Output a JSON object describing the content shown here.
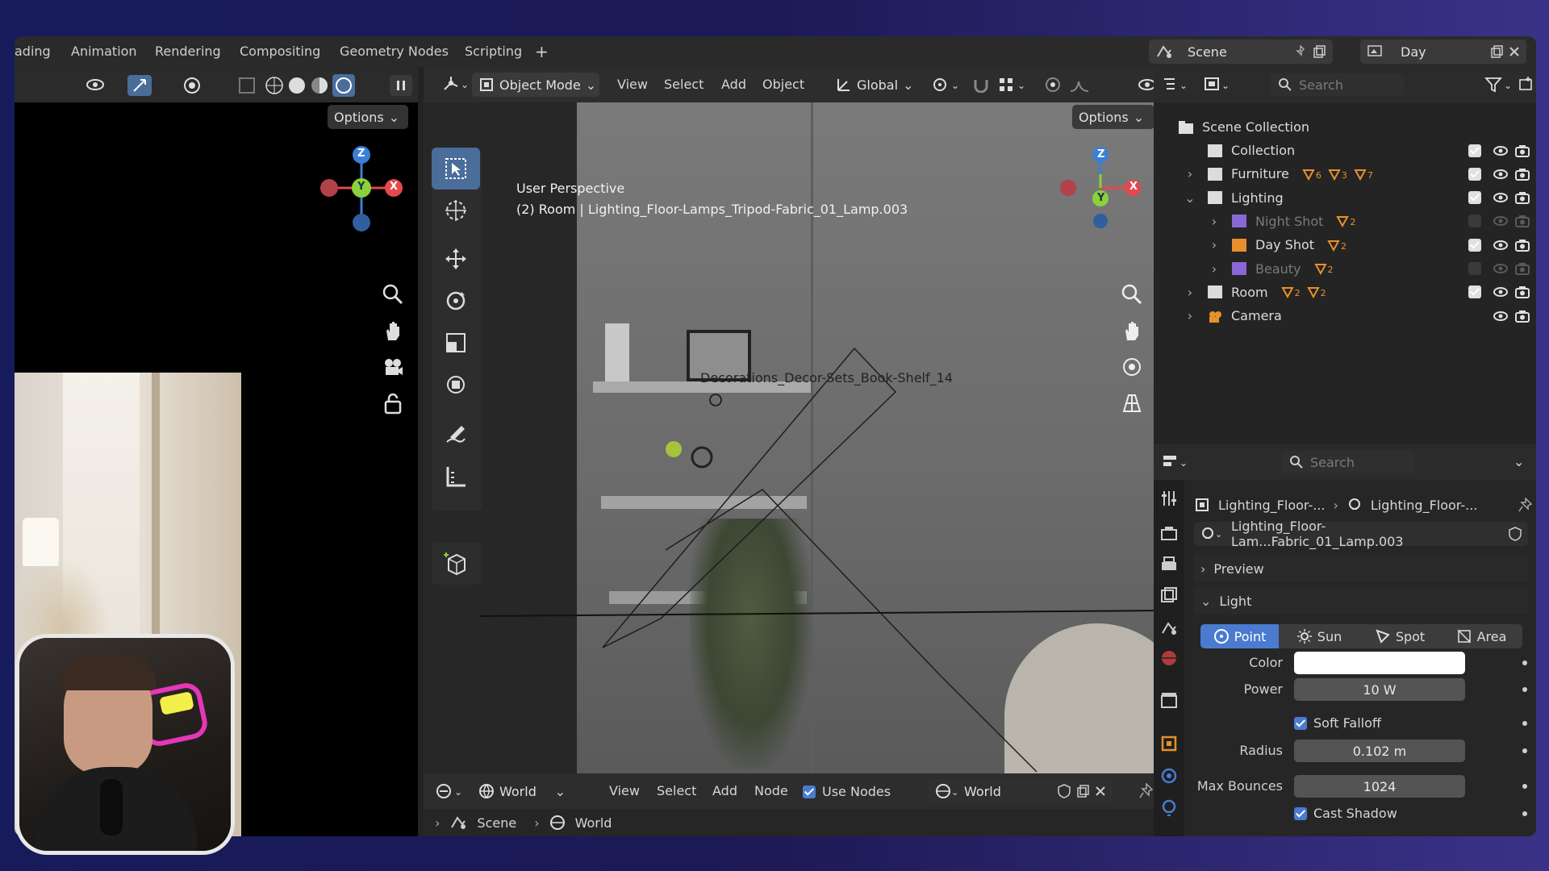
{
  "workspace_tabs": [
    "ading",
    "Animation",
    "Rendering",
    "Compositing",
    "Geometry Nodes",
    "Scripting",
    "+"
  ],
  "scene": {
    "label": "Scene",
    "view_layer": "Day"
  },
  "left_viewport": {
    "options_label": "Options"
  },
  "viewport": {
    "mode": "Object Mode",
    "menus": [
      "View",
      "Select",
      "Add",
      "Object"
    ],
    "transform_orientation": "Global",
    "options_label": "Options",
    "perspective_label": "User Perspective",
    "object_info": "(2) Room | Lighting_Floor-Lamps_Tripod-Fabric_01_Lamp.003",
    "scene_object_label": "Decorations_Decor-Sets_Book-Shelf_14",
    "gizmo_axes": {
      "x": "X",
      "y": "Y",
      "z": "Z"
    }
  },
  "outliner": {
    "search_placeholder": "Search",
    "root": "Scene Collection",
    "rows": [
      {
        "label": "Collection",
        "indent": 0,
        "expander": "",
        "visible": true,
        "checked": true
      },
      {
        "label": "Furniture",
        "indent": 0,
        "expander": "›",
        "visible": true,
        "checked": true,
        "badges": [
          "6",
          "3",
          "7"
        ]
      },
      {
        "label": "Lighting",
        "indent": 0,
        "expander": "⌄",
        "visible": true,
        "checked": true
      },
      {
        "label": "Night Shot",
        "indent": 1,
        "expander": "›",
        "visible": false,
        "checked": false,
        "badges": [
          "2"
        ]
      },
      {
        "label": "Day Shot",
        "indent": 1,
        "expander": "›",
        "visible": true,
        "checked": true,
        "badges": [
          "2"
        ]
      },
      {
        "label": "Beauty",
        "indent": 1,
        "expander": "›",
        "visible": false,
        "checked": false,
        "badges": [
          "2"
        ]
      },
      {
        "label": "Room",
        "indent": 0,
        "expander": "›",
        "visible": true,
        "checked": true,
        "badges": [
          "2",
          "2"
        ]
      },
      {
        "label": "Camera",
        "indent": 0,
        "expander": "›",
        "visible": true,
        "checked": null
      }
    ]
  },
  "properties": {
    "search_placeholder": "Search",
    "breadcrumb": [
      "Lighting_Floor-...",
      "Lighting_Floor-..."
    ],
    "datablock_name": "Lighting_Floor-Lam...Fabric_01_Lamp.003",
    "preview_label": "Preview",
    "light_panel_label": "Light",
    "light_types": [
      "Point",
      "Sun",
      "Spot",
      "Area"
    ],
    "active_light_type": "Point",
    "color_label": "Color",
    "color_value": "#ffffff",
    "power_label": "Power",
    "power_value": "10 W",
    "soft_falloff_label": "Soft Falloff",
    "radius_label": "Radius",
    "radius_value": "0.102 m",
    "max_bounces_label": "Max Bounces",
    "max_bounces_value": "1024",
    "cast_shadow_label": "Cast Shadow"
  },
  "shader_editor": {
    "world_selector": "World",
    "menus": [
      "View",
      "Select",
      "Add",
      "Node"
    ],
    "use_nodes_label": "Use Nodes",
    "world_datablock": "World",
    "breadcrumb": [
      "Scene",
      "World"
    ]
  },
  "colors": {
    "accent": "#4a7bd0",
    "x_axis": "#e5484d",
    "y_axis": "#8bd13b",
    "z_axis": "#3b7fd6"
  }
}
